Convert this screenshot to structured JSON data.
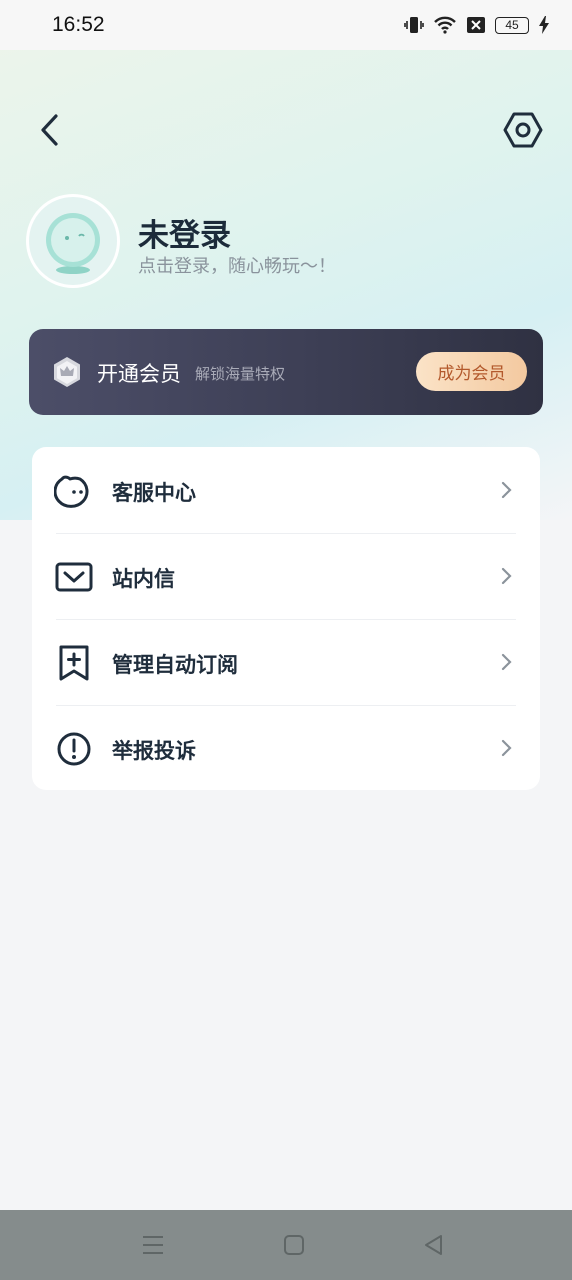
{
  "status_bar": {
    "time": "16:52",
    "battery": "45",
    "icons": [
      "vibrate-icon",
      "wifi-icon",
      "sim-x-icon",
      "battery-icon",
      "charging-icon"
    ]
  },
  "header": {
    "back_icon": "chevron-left-icon",
    "settings_icon": "hexagon-settings-icon"
  },
  "profile": {
    "name": "未登录",
    "subtitle": "点击登录，随心畅玩～！"
  },
  "vip": {
    "title": "开通会员",
    "description": "解锁海量特权",
    "button_label": "成为会员",
    "icon": "crown-badge-icon"
  },
  "menu": {
    "items": [
      {
        "label": "客服中心",
        "icon": "customer-service-icon"
      },
      {
        "label": "站内信",
        "icon": "inbox-icon"
      },
      {
        "label": "管理自动订阅",
        "icon": "bookmark-plus-icon"
      },
      {
        "label": "举报投诉",
        "icon": "alert-circle-icon"
      }
    ]
  },
  "navigation_bar": {
    "icons": [
      "menu-icon",
      "home-square-icon",
      "back-triangle-icon"
    ]
  },
  "colors": {
    "accent_dark": "#1f2d3c",
    "vip_bg": "#3d3f55",
    "vip_button_text": "#b3592c"
  }
}
